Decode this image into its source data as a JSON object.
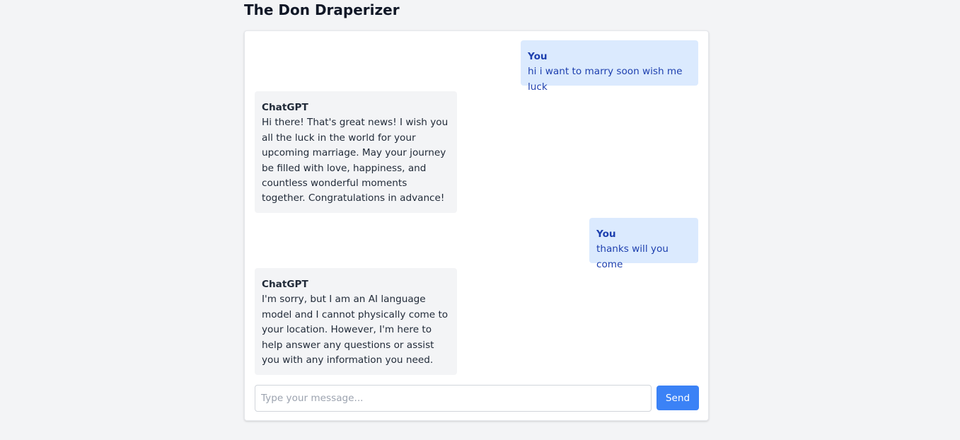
{
  "header": {
    "title": "The Don Draperizer"
  },
  "messages": [
    {
      "role": "user",
      "sender": "You",
      "text": "hi i want to marry soon wish me luck"
    },
    {
      "role": "assistant",
      "sender": "ChatGPT",
      "text": "Hi there! That's great news! I wish you all the luck in the world for your upcoming marriage. May your journey be filled with love, happiness, and countless wonderful moments together. Congratulations in advance!"
    },
    {
      "role": "user",
      "sender": "You",
      "text": "thanks will you come"
    },
    {
      "role": "assistant",
      "sender": "ChatGPT",
      "text": "I'm sorry, but I am an AI language model and I cannot physically come to your location. However, I'm here to help answer any questions or assist you with any information you need."
    }
  ],
  "composer": {
    "placeholder": "Type your message...",
    "value": "",
    "send_label": "Send"
  },
  "colors": {
    "page_background": "#f3f4f6",
    "card_background": "#ffffff",
    "user_bubble": "#dbeafe",
    "user_text": "#1e40af",
    "assistant_bubble": "#f3f4f6",
    "assistant_text": "#1f2937",
    "send_button": "#3b82f6"
  }
}
